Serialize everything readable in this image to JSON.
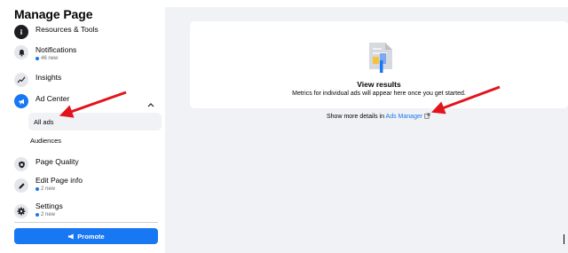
{
  "sidebar": {
    "title": "Manage Page",
    "items": [
      {
        "label": "Resources & Tools",
        "icon": "info-icon"
      },
      {
        "label": "Notifications",
        "icon": "bell-icon",
        "sub": "46 new"
      },
      {
        "label": "Insights",
        "icon": "insights-icon"
      },
      {
        "label": "Ad Center",
        "icon": "megaphone-icon",
        "expanded": true
      },
      {
        "label": "Page Quality",
        "icon": "shield-icon"
      },
      {
        "label": "Edit Page info",
        "icon": "pencil-icon",
        "sub": "2 new"
      },
      {
        "label": "Settings",
        "icon": "gear-icon",
        "sub": "2 new"
      }
    ],
    "ad_center_sub": [
      "All ads",
      "Audiences"
    ],
    "active_sub": "All ads",
    "promote_label": "Promote"
  },
  "main": {
    "card_title": "View results",
    "card_desc": "Metrics for individual ads will appear here once you get started.",
    "more_prefix": "Show more details in",
    "more_link": "Ads Manager"
  },
  "colors": {
    "accent": "#1877f2",
    "background": "#f0f2f5",
    "arrow": "#e3131b"
  }
}
